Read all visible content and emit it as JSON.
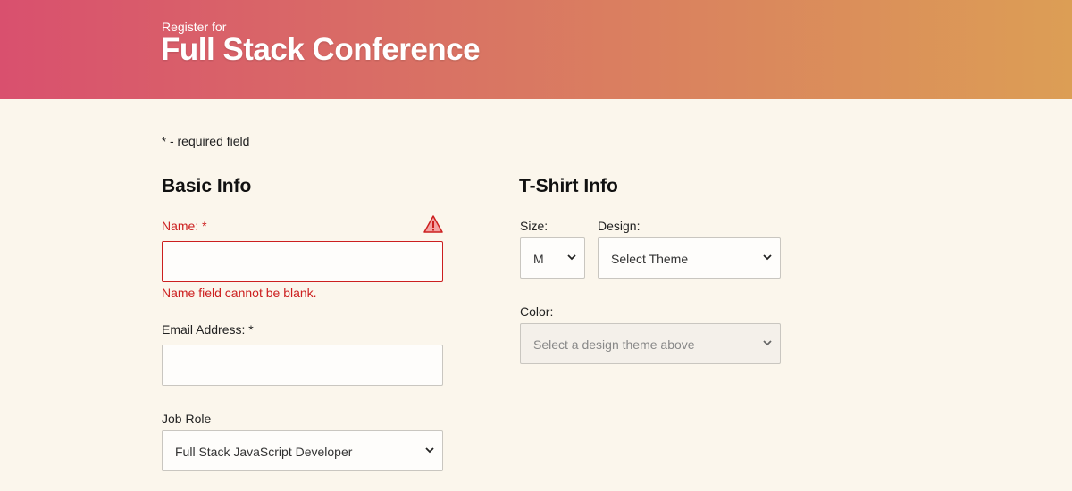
{
  "header": {
    "pre_title": "Register for",
    "title": "Full Stack Conference"
  },
  "required_note": {
    "marker": "*",
    "text": " - required field"
  },
  "basic_info": {
    "heading": "Basic Info",
    "name": {
      "label": "Name:",
      "required_marker": "*",
      "value": "",
      "error": "Name field cannot be blank."
    },
    "email": {
      "label": "Email Address:",
      "required_marker": "*",
      "value": ""
    },
    "job_role": {
      "label": "Job Role",
      "selected": "Full Stack JavaScript Developer"
    }
  },
  "tshirt_info": {
    "heading": "T-Shirt Info",
    "size": {
      "label": "Size:",
      "selected": "M"
    },
    "design": {
      "label": "Design:",
      "selected": "Select Theme"
    },
    "color": {
      "label": "Color:",
      "selected": "Select a design theme above"
    }
  },
  "colors": {
    "error": "#cc1f1f",
    "background": "#fbf6ec",
    "header_gradient_start": "#d9506e",
    "header_gradient_end": "#dc9e55"
  },
  "icons": {
    "warning": "warning-triangle-icon",
    "chevron": "chevron-down-icon"
  }
}
